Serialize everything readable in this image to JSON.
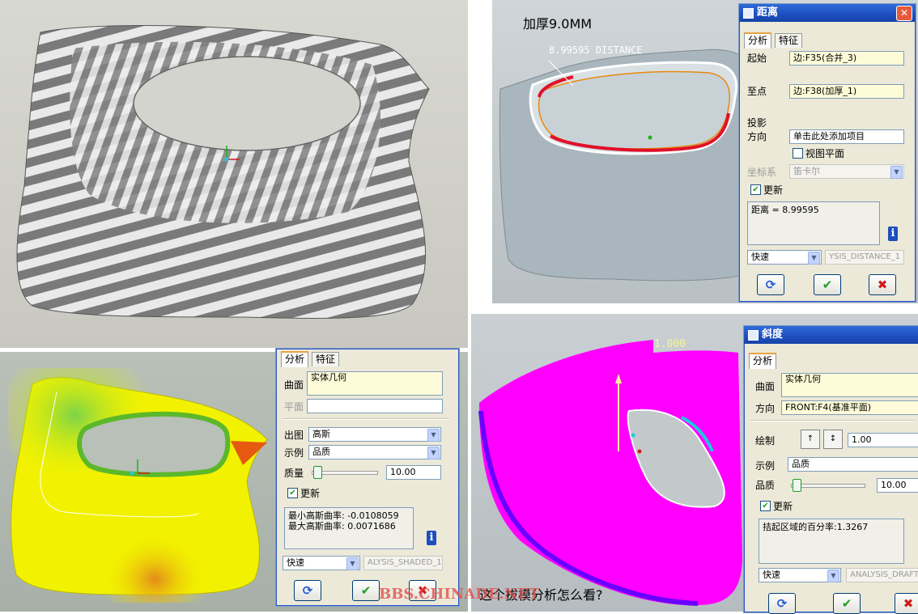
{
  "dialog_distance": {
    "title": "距离",
    "tabs": [
      "分析",
      "特征"
    ],
    "start_label": "起始",
    "start_value": "边:F35(合并_3)",
    "end_label": "至点",
    "end_value": "边:F38(加厚_1)",
    "projection_label_1": "投影",
    "projection_label_2": "方向",
    "projection_value": "单击此处添加项目",
    "view_plane_label": "视图平面",
    "coord_label": "坐标系",
    "coord_value": "笛卡尔",
    "update_label": "更新",
    "result_text": "距离 = 8.99595",
    "mode_value": "快速",
    "analysis_name": "YSIS_DISTANCE_1"
  },
  "dialog_gauss": {
    "tabs": [
      "分析",
      "特征"
    ],
    "surface_label": "曲面",
    "surface_value": "实体几何",
    "plane_label": "平面",
    "plot_label": "出图",
    "plot_value": "高斯",
    "display_label": "示例",
    "display_value": "品质",
    "quality_label": "质量",
    "quality_value": "10.00",
    "update_label": "更新",
    "result_text": "最小高斯曲率: -0.0108059\n最大高斯曲率: 0.0071686",
    "mode_value": "快速",
    "analysis_name": "ALYSIS_SHADED_1"
  },
  "dialog_draft": {
    "title": "斜度",
    "tabs": [
      "分析"
    ],
    "surface_label": "曲面",
    "surface_value": "实体几何",
    "direction_label": "方向",
    "direction_value": "FRONT:F4(基准平面)",
    "draft_label": "绘制",
    "draft_value": "1.00",
    "display_label": "示例",
    "display_value": "品质",
    "quality_label": "品质",
    "quality_value": "10.00",
    "update_label": "更新",
    "result_text": "拮起区域的百分率:1.3267",
    "mode_value": "快速",
    "analysis_name": "ANALYSIS_DRAFT"
  },
  "annotations": {
    "thickness_note": "加厚9.0MM",
    "distance_tag": "8.99595  DISTANCE",
    "draft_tag": "1.000",
    "question": "这个拔模分析怎么看?",
    "watermark": "BBS.CHINADE.NET"
  },
  "colors": {
    "title_bar": "#1e4fbf",
    "dialog_bg": "#ece9d8",
    "draft_magenta": "#ff00ff",
    "gauss_yellow": "#f2f200",
    "watermark": "#e05050"
  }
}
